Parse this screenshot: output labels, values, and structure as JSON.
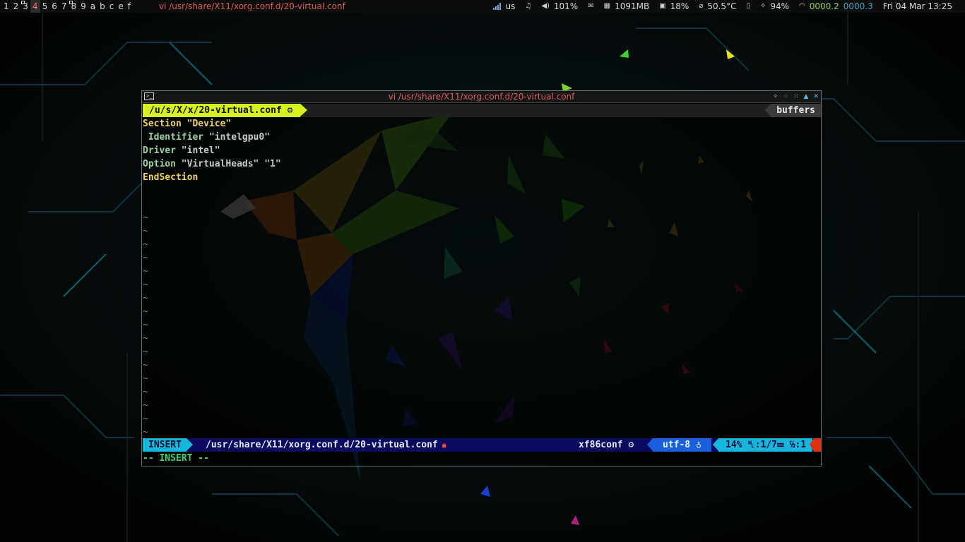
{
  "workspaces": [
    "1",
    "2",
    "3",
    "4",
    "5",
    "6",
    "7",
    "8",
    "9",
    "a",
    "b",
    "c",
    "e",
    "f"
  ],
  "active_workspace": "4",
  "window_title": "vi /usr/share/X11/xorg.conf.d/20-virtual.conf",
  "status": {
    "keyboard": "us",
    "volume": "101%",
    "memory": "1091MB",
    "cpu": "18%",
    "temperature": "50.5°C",
    "battery": "94%",
    "net_down": "0000.2",
    "net_up": "0000.3",
    "clock": "Fri 04 Mar 13:25"
  },
  "colors": {
    "accent_yellow": "#d7f020",
    "mode_cyan": "#17b7dd",
    "statusline_bg": "#0a0a5e",
    "title_red": "#e05a5a",
    "insert_green": "#3ed66b"
  },
  "vim": {
    "tab_label": "/u/s/X/x/20-virtual.conf",
    "tab_icon": "⚙",
    "buffers_label": "buffers",
    "code": [
      {
        "keyword": "Section",
        "value": "\"Device\"",
        "indent": ""
      },
      {
        "keyword": "Identifier",
        "value": "\"intelgpu0\"",
        "indent": " "
      },
      {
        "keyword": "Driver",
        "value": "\"intel\"",
        "indent": ""
      },
      {
        "keyword": "Option",
        "value": "\"VirtualHeads\" \"1\"",
        "indent": ""
      },
      {
        "keyword": "EndSection",
        "value": "",
        "indent": ""
      }
    ],
    "tilde": "~",
    "statusline": {
      "mode": "INSERT",
      "path": "/usr/share/X11/xorg.conf.d/20-virtual.conf",
      "filetype": "xf86conf ⚙",
      "encoding": "utf-8 ♁",
      "position": "14% ␤:1/7☰ ℅:1"
    },
    "cmdline": "-- INSERT --"
  }
}
